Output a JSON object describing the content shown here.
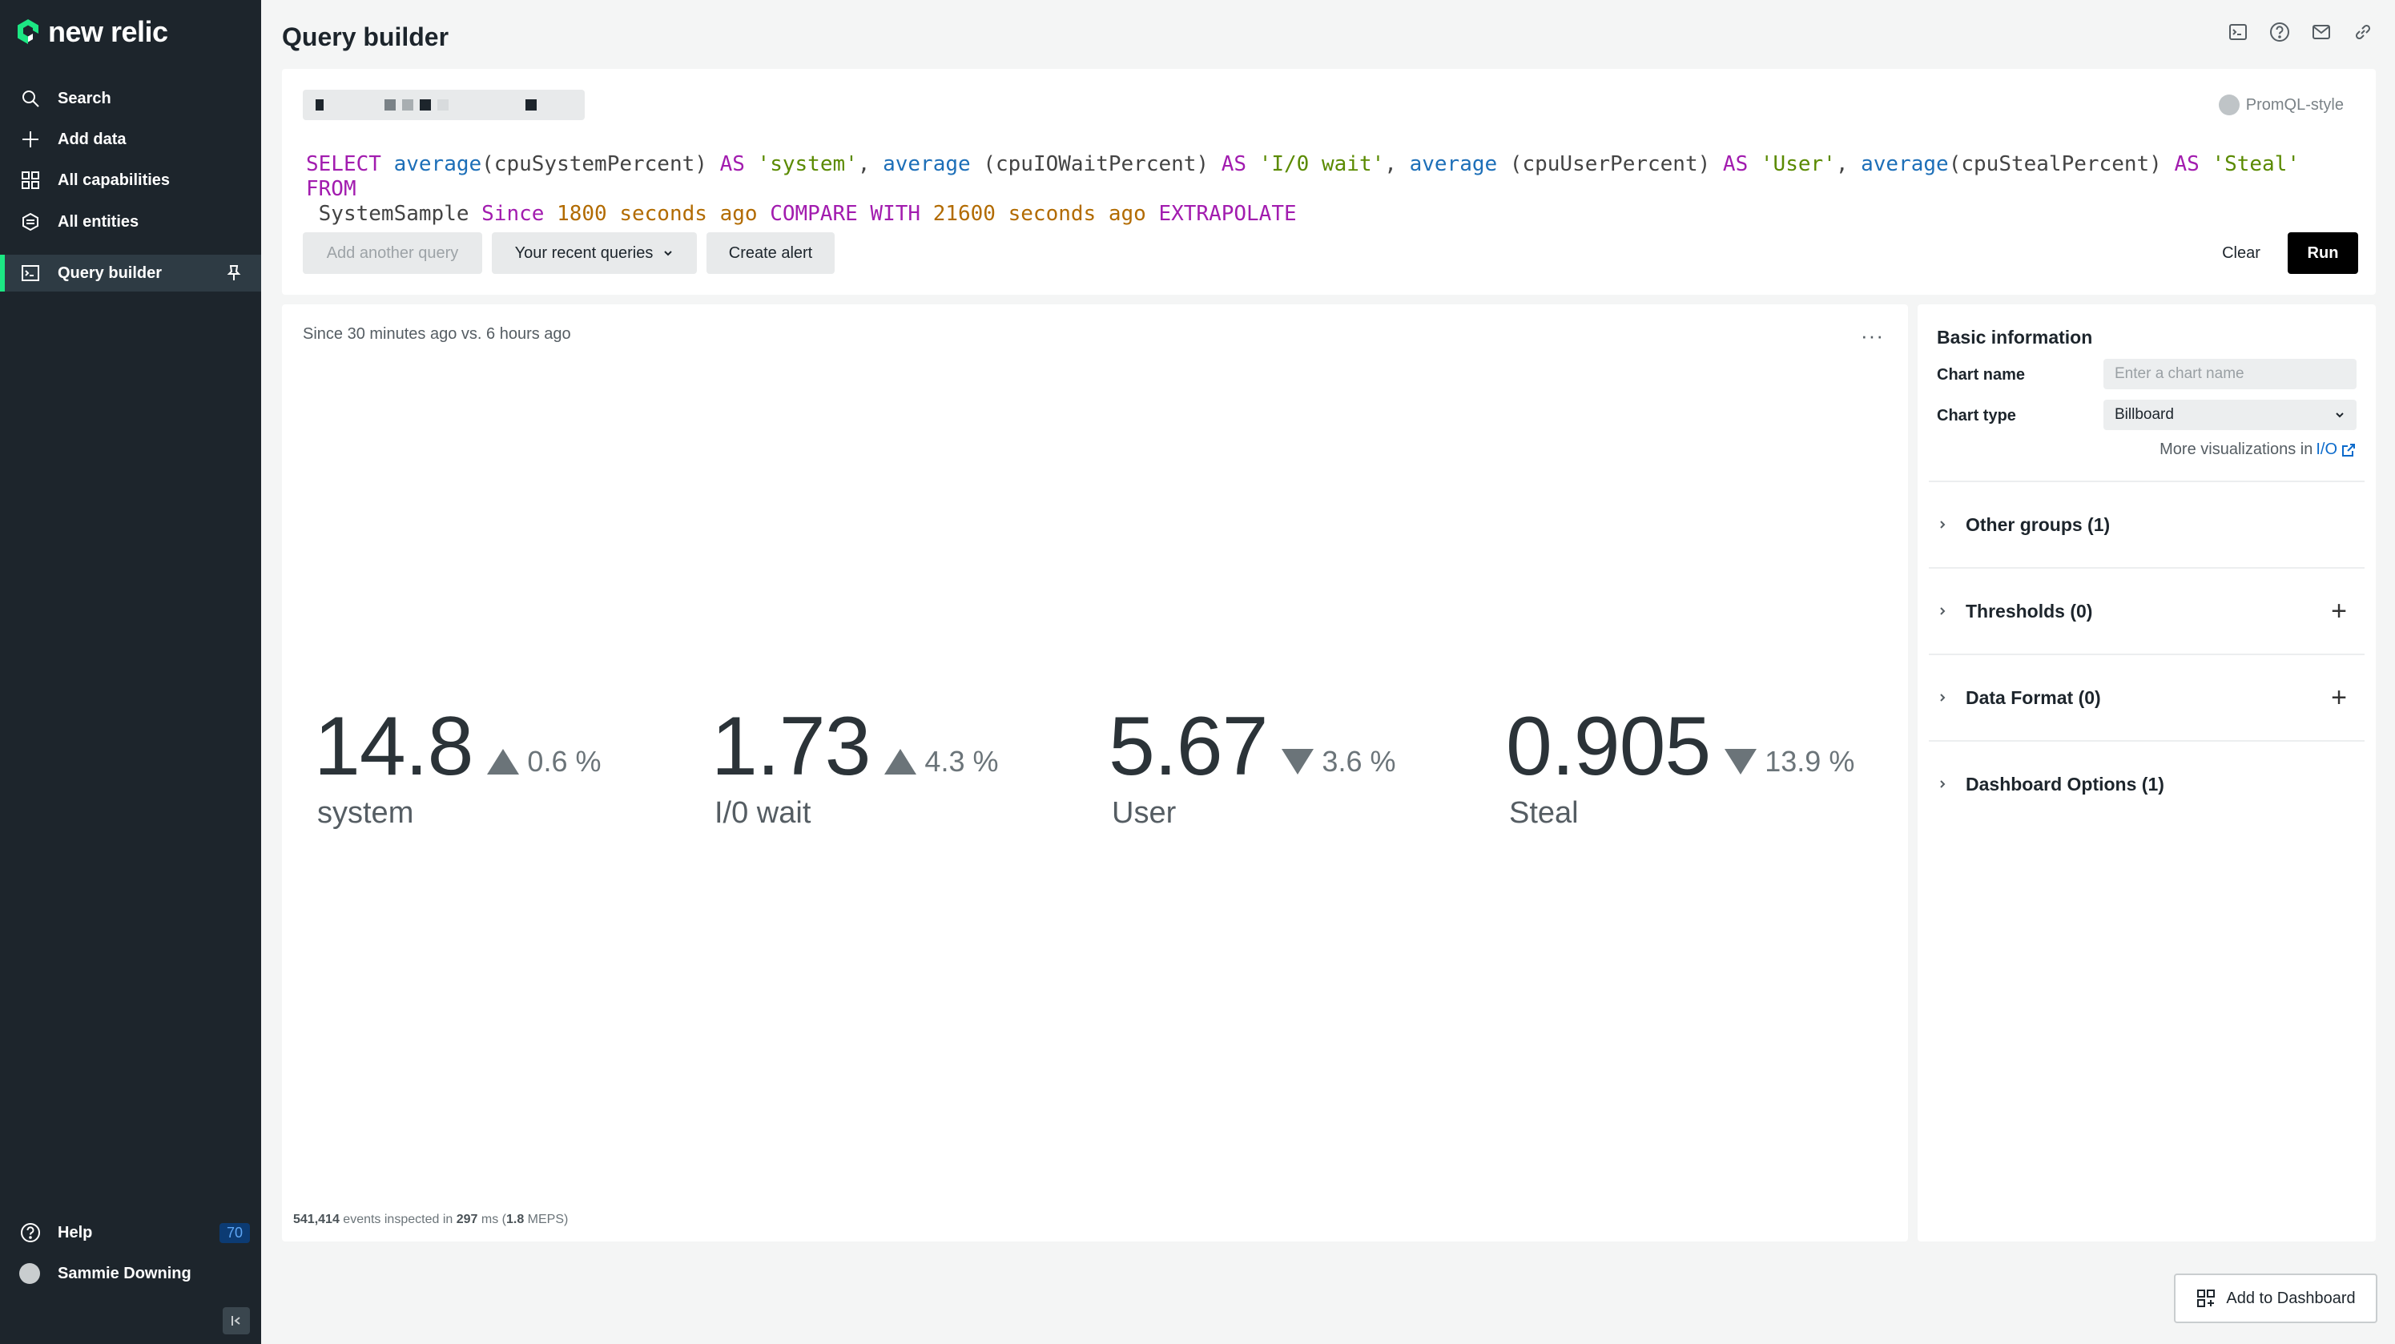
{
  "app": {
    "logo_text": "new relic",
    "brand_color": "#1ce783"
  },
  "sidebar": {
    "items": [
      {
        "label": "Search",
        "icon": "search-icon"
      },
      {
        "label": "Add data",
        "icon": "plus-icon"
      },
      {
        "label": "All capabilities",
        "icon": "grid-icon"
      },
      {
        "label": "All entities",
        "icon": "entities-icon"
      },
      {
        "label": "Query builder",
        "icon": "terminal-icon",
        "active": true
      }
    ],
    "help_label": "Help",
    "help_badge": "70",
    "user_name": "Sammie Downing"
  },
  "header": {
    "title": "Query builder",
    "icons": [
      "terminal-icon",
      "help-icon",
      "mail-icon",
      "link-icon"
    ]
  },
  "query": {
    "mode_label": "PromQL-style",
    "nrql_tokens": [
      {
        "t": "SELECT ",
        "c": "kw"
      },
      {
        "t": "average",
        "c": "fn"
      },
      {
        "t": "(cpuSystemPercent) ",
        "c": ""
      },
      {
        "t": "AS ",
        "c": "kw"
      },
      {
        "t": "'system'",
        "c": "str"
      },
      {
        "t": ", ",
        "c": ""
      },
      {
        "t": "average",
        "c": "fn"
      },
      {
        "t": " (cpuIOWaitPercent) ",
        "c": ""
      },
      {
        "t": "AS ",
        "c": "kw"
      },
      {
        "t": "'I/0 wait'",
        "c": "str"
      },
      {
        "t": ", ",
        "c": ""
      },
      {
        "t": "average",
        "c": "fn"
      },
      {
        "t": " (cpuUserPercent) ",
        "c": ""
      },
      {
        "t": "AS ",
        "c": "kw"
      },
      {
        "t": "'User'",
        "c": "str"
      },
      {
        "t": ", ",
        "c": ""
      },
      {
        "t": "average",
        "c": "fn"
      },
      {
        "t": "(cpuStealPercent) ",
        "c": ""
      },
      {
        "t": "AS ",
        "c": "kw"
      },
      {
        "t": "'Steal'",
        "c": "str"
      },
      {
        "t": " FROM",
        "c": "kw"
      },
      {
        "t": "\n SystemSample ",
        "c": ""
      },
      {
        "t": "Since ",
        "c": "kw"
      },
      {
        "t": "1800 seconds ago ",
        "c": "num"
      },
      {
        "t": "COMPARE WITH ",
        "c": "kw"
      },
      {
        "t": "21600 seconds ago ",
        "c": "num"
      },
      {
        "t": "EXTRAPOLATE",
        "c": "kw"
      }
    ],
    "buttons": {
      "add_another": "Add another query",
      "recent": "Your recent queries",
      "create_alert": "Create alert",
      "clear": "Clear",
      "run": "Run"
    }
  },
  "chart": {
    "since_text": "Since 30 minutes ago vs. 6 hours ago",
    "more_label": "···",
    "footer": {
      "events": "541,414",
      "events_text": " events inspected in ",
      "ms": "297",
      "ms_text": " ms (",
      "meps": "1.8",
      "meps_text": " MEPS)"
    }
  },
  "chart_data": {
    "type": "billboard",
    "metrics": [
      {
        "label": "system",
        "value": "14.8",
        "change": "0.6 %",
        "direction": "up"
      },
      {
        "label": "I/0 wait",
        "value": "1.73",
        "change": "4.3 %",
        "direction": "up"
      },
      {
        "label": "User",
        "value": "5.67",
        "change": "3.6 %",
        "direction": "down"
      },
      {
        "label": "Steal",
        "value": "0.905",
        "change": "13.9 %",
        "direction": "down"
      }
    ]
  },
  "config": {
    "title": "Basic information",
    "chart_name_label": "Chart name",
    "chart_name_placeholder": "Enter a chart name",
    "chart_type_label": "Chart type",
    "chart_type_value": "Billboard",
    "more_vis_text": "More visualizations in",
    "more_vis_link": "I/O",
    "groups": [
      {
        "label": "Other groups (1)",
        "addable": false
      },
      {
        "label": "Thresholds (0)",
        "addable": true
      },
      {
        "label": "Data Format (0)",
        "addable": true
      },
      {
        "label": "Dashboard Options (1)",
        "addable": false
      }
    ]
  },
  "add_to_dashboard": "Add to Dashboard"
}
